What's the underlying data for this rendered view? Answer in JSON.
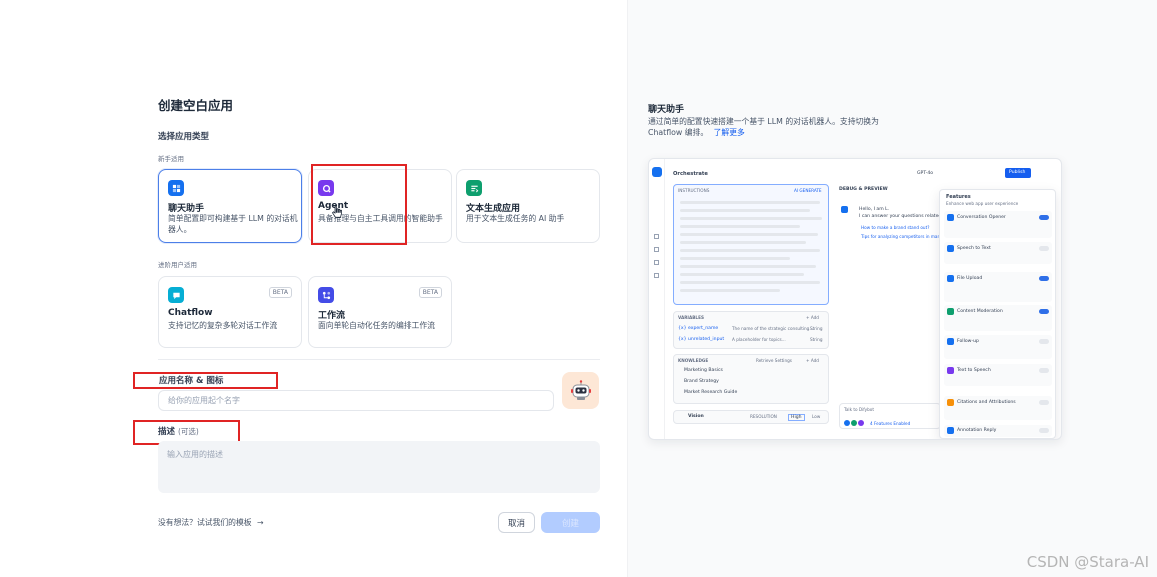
{
  "dialog": {
    "title": "创建空白应用",
    "choose_type_label": "选择应用类型",
    "beginner_label": "新手适用",
    "advanced_label": "进阶用户适用",
    "app_types_beginner": [
      {
        "name": "聊天助手",
        "desc": "简单配置即可构建基于 LLM 的对话机器人。",
        "icon": "chat-bubble-icon",
        "color": "#1570ef"
      },
      {
        "name": "Agent",
        "desc": "具备推理与自主工具调用的智能助手",
        "icon": "agent-icon",
        "color": "#7839ee"
      },
      {
        "name": "文本生成应用",
        "desc": "用于文本生成任务的 AI 助手",
        "icon": "text-generation-icon",
        "color": "#0e9f6e"
      }
    ],
    "app_types_advanced": [
      {
        "name": "Chatflow",
        "desc": "支持记忆的复杂多轮对话工作流",
        "badge": "BETA",
        "icon": "chatflow-icon",
        "color": "#06aed4"
      },
      {
        "name": "工作流",
        "desc": "面向单轮自动化任务的编排工作流",
        "badge": "BETA",
        "icon": "workflow-icon",
        "color": "#444ce7"
      }
    ],
    "name_icon_label": "应用名称 & 图标",
    "name_placeholder": "给你的应用起个名字",
    "desc_label": "描述",
    "desc_optional": "(可选)",
    "desc_placeholder": "输入应用的描述",
    "template_link": "没有想法？试试我们的模板",
    "cancel_label": "取消",
    "create_label": "创建"
  },
  "preview": {
    "title": "聊天助手",
    "desc_line1": "通过简单的配置快速搭建一个基于 LLM 的对话机器人。支持切换为",
    "desc_line2": "Chatflow 编排。",
    "learn_more": "了解更多",
    "mock": {
      "header": "Orchestrate",
      "model": "GPT-4o",
      "publish": "Publish",
      "instructions": "INSTRUCTIONS",
      "generate": "AI GENERATE",
      "debug": "DEBUG & PREVIEW",
      "greeting1": "Hello, I am L.",
      "greeting2": "I can answer your questions related",
      "suggestions": [
        "How to make a brand stand out?",
        "Tips for analyzing competitors in market"
      ],
      "variables": "VARIABLES",
      "var_rows": [
        {
          "name": "{x} expert_name",
          "hint": "The name of the strategic consulting...",
          "type": "String"
        },
        {
          "name": "{x} unrelated_input",
          "hint": "A placeholder for topics...",
          "type": "String"
        }
      ],
      "knowledge": "KNOWLEDGE",
      "retrieve": "Retrieve Settings",
      "add": "+ Add",
      "kb_rows": [
        "Marketing Basics",
        "Brand Strategy",
        "Market Research Guide"
      ],
      "vision": "Vision",
      "resolution": "RESOLUTION",
      "high": "High",
      "low": "Low",
      "talk": "Talk to Difybot",
      "features_enabled": "4 Features Enabled",
      "features": "Features",
      "features_sub": "Enhance web app user experience",
      "feature_items": [
        {
          "name": "Conversation Opener",
          "color": "#1570ef",
          "on": true
        },
        {
          "name": "Speech to Text",
          "color": "#1570ef",
          "on": false
        },
        {
          "name": "File Upload",
          "color": "#1570ef",
          "on": true
        },
        {
          "name": "Content Moderation",
          "color": "#0e9f6e",
          "on": true
        },
        {
          "name": "Follow-up",
          "color": "#1570ef",
          "on": false
        },
        {
          "name": "Text to Speech",
          "color": "#7839ee",
          "on": false
        },
        {
          "name": "Citations and Attributions",
          "color": "#f79009",
          "on": false
        },
        {
          "name": "Annotation Reply",
          "color": "#1570ef",
          "on": false
        }
      ]
    }
  },
  "watermark": "CSDN @Stara-AI"
}
